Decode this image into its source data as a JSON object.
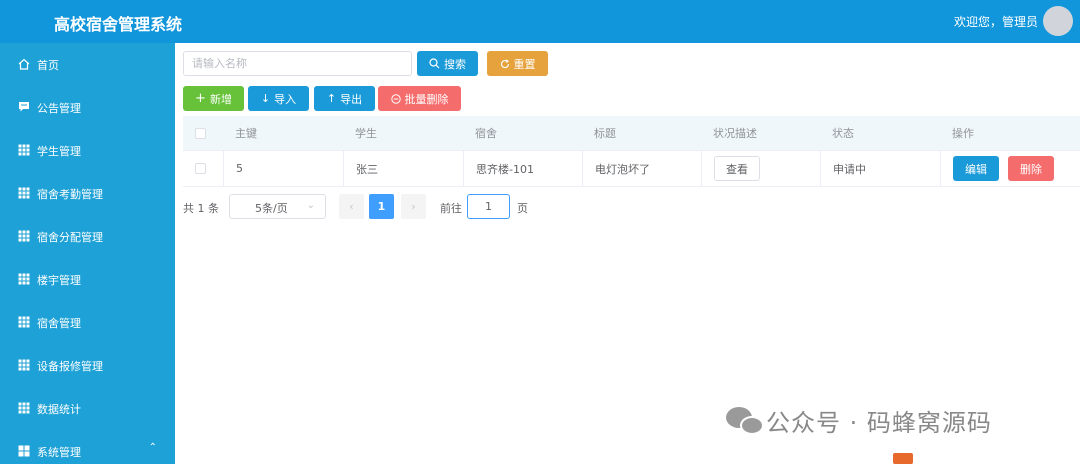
{
  "header": {
    "title": "高校宿舍管理系统",
    "welcome": "欢迎您，管理员"
  },
  "sidebar": {
    "items": [
      {
        "label": "首页",
        "icon": "home-icon"
      },
      {
        "label": "公告管理",
        "icon": "message-icon"
      },
      {
        "label": "学生管理",
        "icon": "grid-icon"
      },
      {
        "label": "宿舍考勤管理",
        "icon": "grid-icon"
      },
      {
        "label": "宿舍分配管理",
        "icon": "grid-icon"
      },
      {
        "label": "楼宇管理",
        "icon": "grid-icon"
      },
      {
        "label": "宿舍管理",
        "icon": "grid-icon"
      },
      {
        "label": "设备报修管理",
        "icon": "grid-icon"
      },
      {
        "label": "数据统计",
        "icon": "grid-icon"
      },
      {
        "label": "系统管理",
        "icon": "menu-icon"
      }
    ]
  },
  "toolbar": {
    "search_placeholder": "请输入名称",
    "search_label": "搜索",
    "reset_label": "重置",
    "add_label": "新增",
    "import_label": "导入",
    "export_label": "导出",
    "batch_delete_label": "批量删除"
  },
  "table": {
    "headers": [
      "主键",
      "学生",
      "宿舍",
      "标题",
      "状况描述",
      "状态",
      "操作"
    ],
    "rows": [
      {
        "id": "5",
        "student": "张三",
        "dorm": "思齐楼-101",
        "title": "电灯泡坏了",
        "desc_action": "查看",
        "status": "申请中",
        "edit": "编辑",
        "delete": "删除"
      }
    ]
  },
  "pagination": {
    "total": "共 1 条",
    "page_size": "5条/页",
    "current_page": "1",
    "goto_label": "前往",
    "goto_value": "1",
    "page_unit": "页"
  },
  "watermark": {
    "text": "公众号 · 码蜂窝源码"
  },
  "colors": {
    "header_bg": "#1296db",
    "sidebar_bg": "#1da1d6",
    "primary": "#1a9ad8",
    "success": "#67c23a",
    "warning": "#e6a23c",
    "danger": "#f56c6c",
    "active_page": "#409eff"
  }
}
